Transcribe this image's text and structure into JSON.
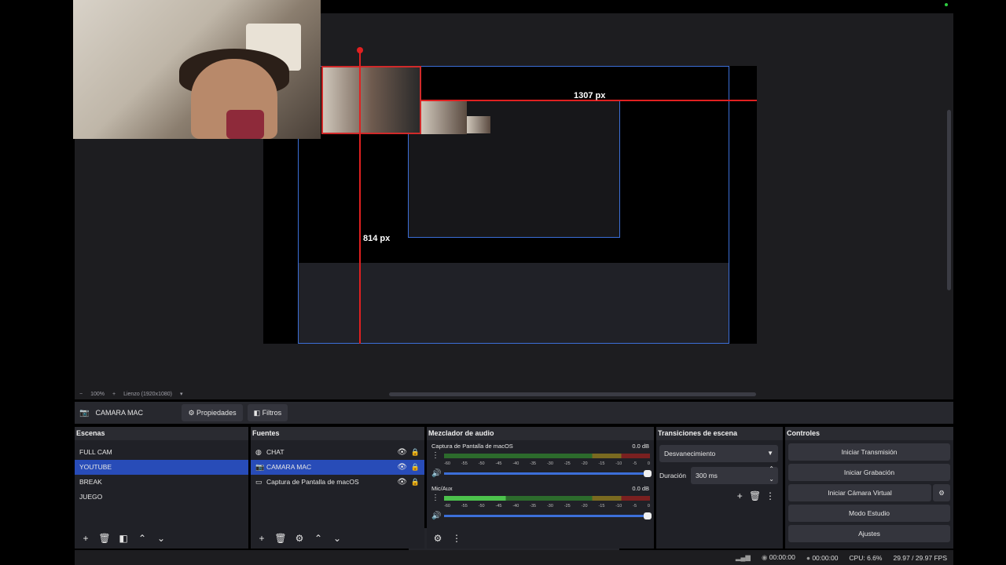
{
  "preview": {
    "measure_width": "1307 px",
    "measure_height": "814 px",
    "zoom": "100%",
    "zoom_minus": "−",
    "zoom_plus": "+",
    "canvas_label": "Lienzo (1920x1080)"
  },
  "source_toolbar": {
    "selected_source": "CAMARA MAC",
    "properties_label": "Propiedades",
    "filters_label": "Filtros"
  },
  "scenes": {
    "title": "Escenas",
    "items": [
      "FULL CAM",
      "YOUTUBE",
      "BREAK",
      "JUEGO"
    ],
    "selected_index": 1
  },
  "sources": {
    "title": "Fuentes",
    "items": [
      {
        "label": "CHAT",
        "icon": "browser-icon"
      },
      {
        "label": "CAMARA MAC",
        "icon": "camera-icon"
      },
      {
        "label": "Captura de Pantalla de macOS",
        "icon": "display-icon"
      }
    ],
    "selected_index": 1
  },
  "mixer": {
    "title": "Mezclador de audio",
    "channels": [
      {
        "name": "Captura de Pantalla de macOS",
        "db": "0.0 dB",
        "level": 0.0
      },
      {
        "name": "Mic/Aux",
        "db": "0.0 dB",
        "level": 0.3
      }
    ],
    "ticks": [
      "-60",
      "-55",
      "-50",
      "-45",
      "-40",
      "-35",
      "-30",
      "-25",
      "-20",
      "-15",
      "-10",
      "-5",
      "0"
    ]
  },
  "transitions": {
    "title": "Transiciones de escena",
    "selected": "Desvanecimiento",
    "duration_label": "Duración",
    "duration_value": "300 ms"
  },
  "controls": {
    "title": "Controles",
    "start_stream": "Iniciar Transmisión",
    "start_record": "Iniciar Grabación",
    "start_virtual_cam": "Iniciar Cámara Virtual",
    "studio_mode": "Modo Estudio",
    "settings": "Ajustes"
  },
  "status": {
    "stream_time": "00:00:00",
    "record_time": "00:00:00",
    "cpu": "CPU: 6.6%",
    "fps": "29.97 / 29.97 FPS"
  },
  "colors": {
    "selection": "#284cb8",
    "dock_bg": "#202127",
    "measure_line": "#e02020"
  }
}
